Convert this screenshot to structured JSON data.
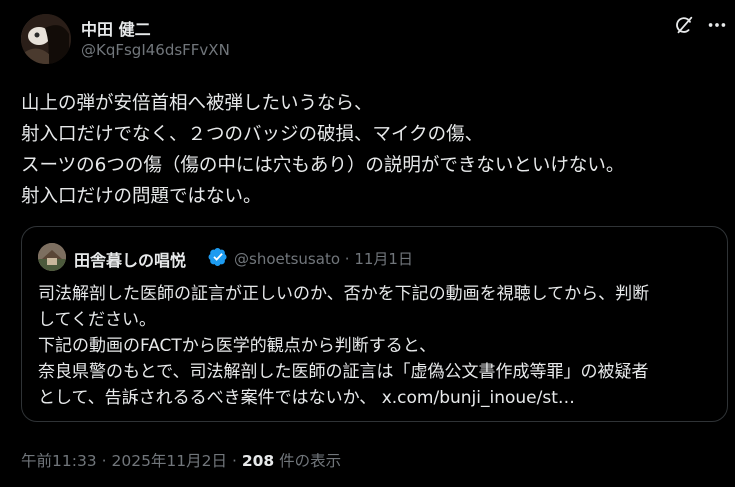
{
  "author": {
    "name": "中田 健二",
    "handle": "@KqFsgI46dsFFvXN"
  },
  "icons": {
    "grok": "grok-icon",
    "more": "more-icon"
  },
  "post": {
    "lines": [
      "山上の弾が安倍首相へ被弾したいうなら、",
      "射入口だけでなく、２つのバッジの破損、マイクの傷、",
      "スーツの6つの傷（傷の中には穴もあり）の説明ができないといけない。",
      "射入口だけの問題ではない。"
    ]
  },
  "quote": {
    "name": "田舎暮しの唱悦",
    "handle": "@shoetsusato",
    "separator": "·",
    "date": "11月1日",
    "verified_color": "#1d9bf0",
    "lines": [
      "司法解剖した医師の証言が正しいのか、否かを下記の動画を視聴してから、判断",
      "してください。",
      "下記の動画のFACTから医学的観点から判断すると、",
      "奈良県警のもとで、司法解剖した医師の証言は「虚偽公文書作成等罪」の被疑者",
      "として、告訴されるるべき案件ではないか、 x.com/bunji_inoue/st…"
    ]
  },
  "meta": {
    "time": "午前11:33",
    "separator": "·",
    "date": "2025年11月2日",
    "views_count": "208",
    "views_label": "件の表示"
  }
}
